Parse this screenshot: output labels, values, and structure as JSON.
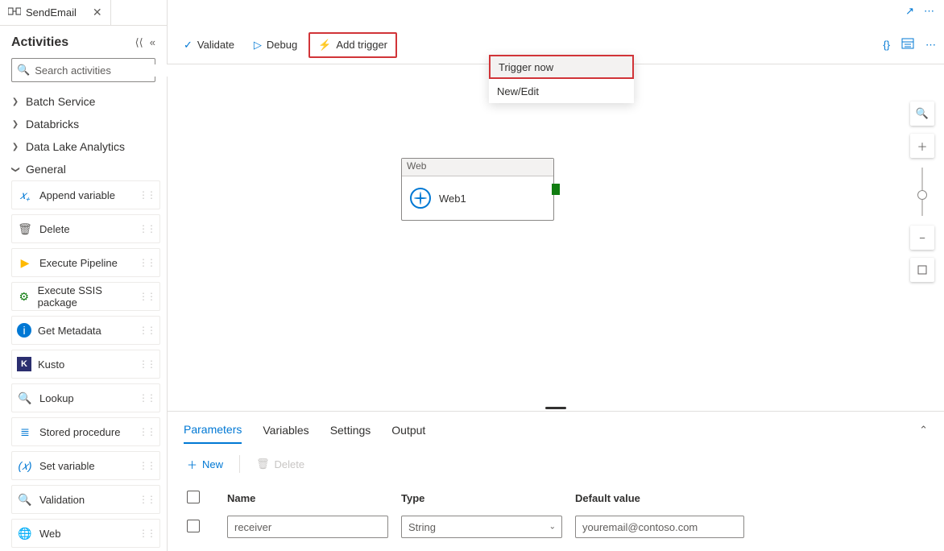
{
  "tab": {
    "title": "SendEmail"
  },
  "sidebar": {
    "title": "Activities",
    "search_placeholder": "Search activities",
    "groups": [
      {
        "label": "Batch Service",
        "expanded": false
      },
      {
        "label": "Databricks",
        "expanded": false
      },
      {
        "label": "Data Lake Analytics",
        "expanded": false
      },
      {
        "label": "General",
        "expanded": true
      }
    ],
    "items": [
      {
        "label": "Append variable",
        "icon": "𝑥₊",
        "color": "#0078d4"
      },
      {
        "label": "Delete",
        "icon": "🗑",
        "color": "#605e5c"
      },
      {
        "label": "Execute Pipeline",
        "icon": "▶",
        "color": "#0078d4"
      },
      {
        "label": "Execute SSIS package",
        "icon": "⚙",
        "color": "#107c10"
      },
      {
        "label": "Get Metadata",
        "icon": "ℹ",
        "color": "#0078d4"
      },
      {
        "label": "Kusto",
        "icon": "K",
        "color": "#2b2e6f"
      },
      {
        "label": "Lookup",
        "icon": "🔍",
        "color": "#d29200"
      },
      {
        "label": "Stored procedure",
        "icon": "≣",
        "color": "#0078d4"
      },
      {
        "label": "Set variable",
        "icon": "(𝑥)",
        "color": "#0078d4"
      },
      {
        "label": "Validation",
        "icon": "🔍",
        "color": "#0078d4"
      },
      {
        "label": "Web",
        "icon": "🌐",
        "color": "#0078d4"
      }
    ]
  },
  "toolbar": {
    "validate": "Validate",
    "debug": "Debug",
    "add_trigger": "Add trigger"
  },
  "trigger_menu": {
    "item0": "Trigger now",
    "item1": "New/Edit"
  },
  "canvas_node": {
    "type": "Web",
    "name": "Web1"
  },
  "bottom_tabs": {
    "t0": "Parameters",
    "t1": "Variables",
    "t2": "Settings",
    "t3": "Output"
  },
  "params": {
    "new_label": "New",
    "delete_label": "Delete",
    "cols": {
      "name": "Name",
      "type": "Type",
      "def": "Default value"
    },
    "rows": [
      {
        "name": "receiver",
        "type": "String",
        "def": "youremail@contoso.com"
      }
    ]
  }
}
